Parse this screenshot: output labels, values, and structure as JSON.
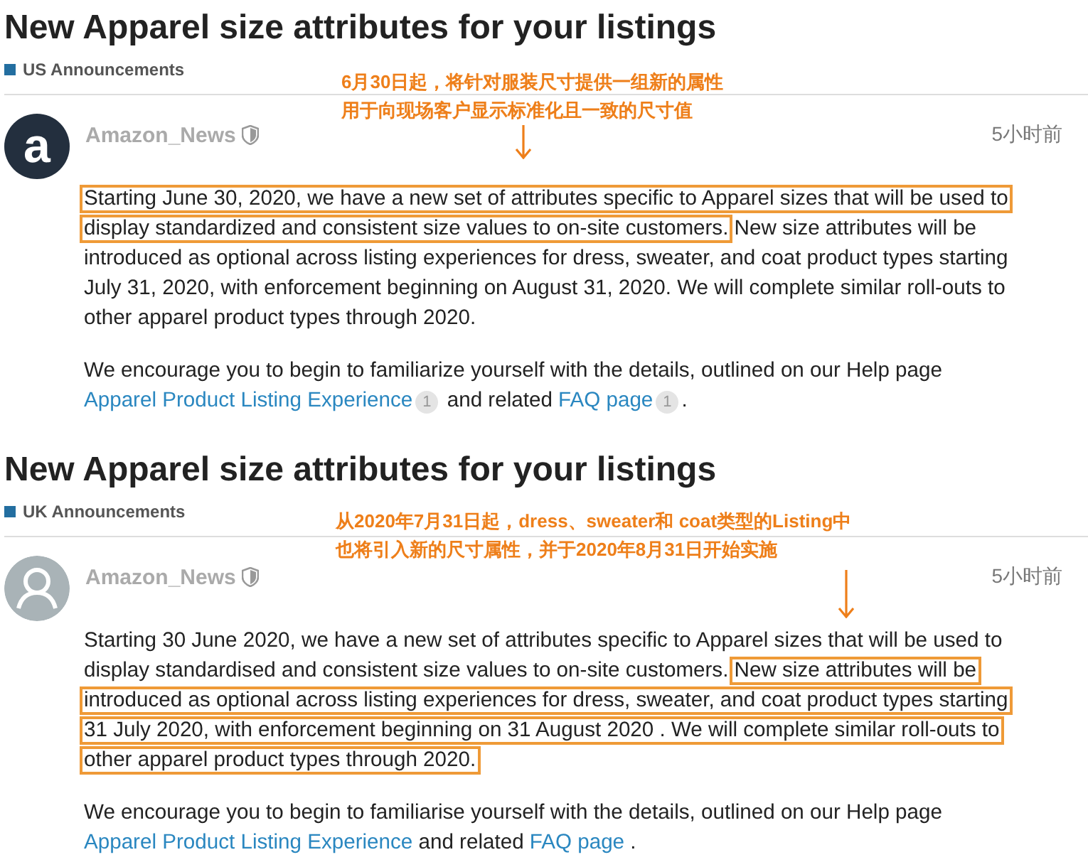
{
  "posts": [
    {
      "title": "New Apparel size attributes for your listings",
      "category": "US Announcements",
      "annotation": {
        "lines": [
          "6月30日起，将针对服装尺寸提供一组新的属性",
          "用于向现场客户显示标准化且一致的尺寸值"
        ]
      },
      "author": {
        "avatar": {
          "kind": "logo",
          "letter": "a"
        },
        "name": "Amazon_News",
        "time": "5小时前"
      },
      "paragraphs": [
        {
          "segments": [
            {
              "kind": "text",
              "highlighted": true,
              "text": "Starting June 30, 2020, we have a new set of attributes specific to Apparel sizes that will be used to display standardized and consistent size values to on-site customers."
            },
            {
              "kind": "text",
              "highlighted": false,
              "text": " New size attributes will be introduced as optional across listing experiences for dress, sweater, and coat product types starting July 31, 2020, with enforcement beginning on August 31, 2020. We will complete similar roll-outs to other apparel product types through 2020."
            }
          ]
        },
        {
          "segments": [
            {
              "kind": "text",
              "highlighted": false,
              "text": "We encourage you to begin to familiarize yourself with the details, outlined on our Help page "
            },
            {
              "kind": "link",
              "text": "Apparel Product Listing Experience"
            },
            {
              "kind": "badge",
              "text": "1"
            },
            {
              "kind": "text",
              "highlighted": false,
              "text": " and related "
            },
            {
              "kind": "link",
              "text": "FAQ page"
            },
            {
              "kind": "badge",
              "text": "1"
            },
            {
              "kind": "text",
              "highlighted": false,
              "text": "."
            }
          ]
        }
      ]
    },
    {
      "title": "New Apparel size attributes for your listings",
      "category": "UK Announcements",
      "annotation": {
        "lines": [
          "从2020年7月31日起，dress、sweater和 coat类型的Listing中",
          "也将引入新的尺寸属性，并于2020年8月31日开始实施"
        ]
      },
      "author": {
        "avatar": {
          "kind": "user"
        },
        "name": "Amazon_News",
        "time": "5小时前"
      },
      "paragraphs": [
        {
          "segments": [
            {
              "kind": "text",
              "highlighted": false,
              "text": "Starting 30 June 2020, we have a new set of attributes specific to Apparel sizes that will be used to display standardised and consistent size values to on-site customers. "
            },
            {
              "kind": "text",
              "highlighted": true,
              "text": "New size attributes will be introduced as optional across listing experiences for dress, sweater, and coat product types starting 31 July 2020, with enforcement beginning on 31 August 2020 . We will complete similar roll-outs to other apparel product types through 2020."
            }
          ]
        },
        {
          "segments": [
            {
              "kind": "text",
              "highlighted": false,
              "text": "We encourage you to begin to familiarise yourself with the details, outlined on our Help page "
            },
            {
              "kind": "link",
              "text": "Apparel Product Listing Experience"
            },
            {
              "kind": "text",
              "highlighted": false,
              "text": " and related "
            },
            {
              "kind": "link",
              "text": "FAQ page"
            },
            {
              "kind": "text",
              "highlighted": false,
              "text": " ."
            }
          ]
        }
      ]
    }
  ]
}
